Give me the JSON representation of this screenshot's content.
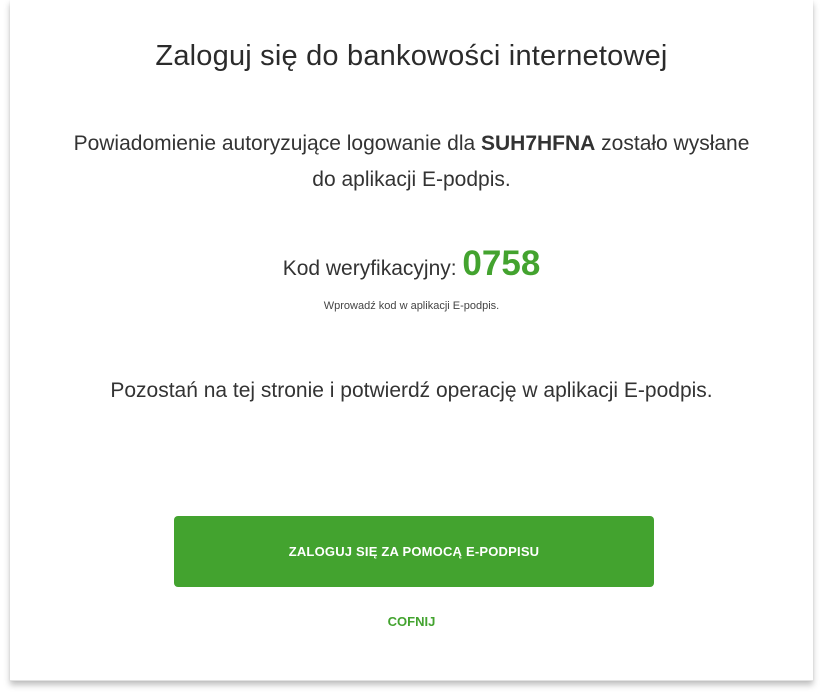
{
  "title": "Zaloguj się do bankowości internetowej",
  "message": {
    "part1": "Powiadomienie autoryzujące logowanie dla ",
    "user_id": "SUH7HFNA",
    "part2": " zostało wysłane do aplikacji E-podpis."
  },
  "verification": {
    "label": "Kod weryfikacyjny: ",
    "code": "0758",
    "hint": "Wprowadź kod w aplikacji E-podpis."
  },
  "instruction": "Pozostań na tej stronie i potwierdź operację w aplikacji E-podpis.",
  "buttons": {
    "login_label": "ZALOGUJ SIĘ ZA POMOCĄ E-PODPISU",
    "back_label": "COFNIJ"
  },
  "colors": {
    "accent": "#43a32f",
    "text": "#333333"
  }
}
